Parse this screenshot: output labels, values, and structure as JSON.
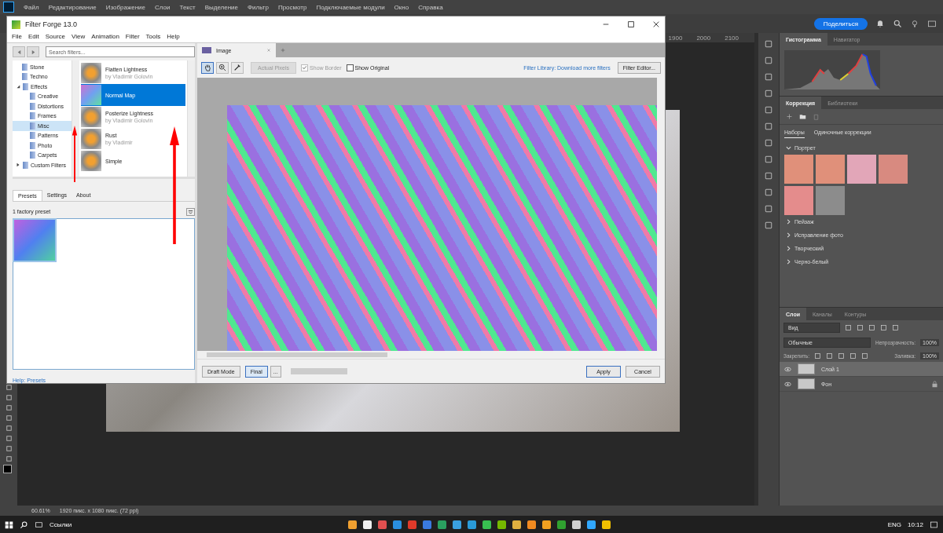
{
  "photoshop": {
    "menu": [
      "Файл",
      "Редактирование",
      "Изображение",
      "Слои",
      "Текст",
      "Выделение",
      "Фильтр",
      "Просмотр",
      "Подключаемые модули",
      "Окно",
      "Справка"
    ],
    "share_button": "Поделиться",
    "ruler": [
      "1900",
      "2000",
      "2100"
    ],
    "histogram_panel": {
      "tabs": [
        {
          "label": "Гистограмма",
          "selected": true
        },
        {
          "label": "Навигатор",
          "selected": false
        }
      ]
    },
    "adjustments_panel": {
      "tabs": [
        {
          "label": "Коррекция",
          "selected": true
        },
        {
          "label": "Библиотеки",
          "selected": false
        }
      ],
      "subtabs": [
        {
          "label": "Наборы",
          "selected": true
        },
        {
          "label": "Одиночные коррекции",
          "selected": false
        }
      ],
      "groups": [
        {
          "label": "Портрет",
          "expanded": true,
          "thumbnails": [
            {
              "color": "#e0907a"
            },
            {
              "color": "#e0907a"
            },
            {
              "color": "#e2a6b8"
            },
            {
              "color": "#d88a80"
            },
            {
              "color": "#e48c8c"
            },
            {
              "color": "#8c8c8c"
            }
          ]
        },
        {
          "label": "Пейзаж",
          "expanded": false
        },
        {
          "label": "Исправление фото",
          "expanded": false
        },
        {
          "label": "Творческий",
          "expanded": false
        },
        {
          "label": "Черно-белый",
          "expanded": false
        }
      ]
    },
    "layers_panel": {
      "tabs": [
        {
          "label": "Слои",
          "selected": true
        },
        {
          "label": "Каналы",
          "selected": false
        },
        {
          "label": "Контуры",
          "selected": false
        }
      ],
      "filter": "Вид",
      "blend_mode": "Обычные",
      "opacity_label": "Непрозрачность:",
      "opacity": "100%",
      "lock_label": "Закрепить:",
      "fill_label": "Заливка:",
      "fill": "100%",
      "layers": [
        {
          "name": "Слой 1",
          "selected": true,
          "locked": false
        },
        {
          "name": "Фон",
          "selected": false,
          "locked": true
        }
      ]
    },
    "status_bar": {
      "zoom": "60.61%",
      "doc_info": "1920 пикс. x 1080 пикс. (72 ppi)"
    }
  },
  "dialog": {
    "title": "Filter Forge 13.0",
    "menu": [
      "File",
      "Edit",
      "Source",
      "View",
      "Animation",
      "Filter",
      "Tools",
      "Help"
    ],
    "search": {
      "placeholder": "Search filters..."
    },
    "tree": [
      {
        "label": "Stone",
        "selected": false
      },
      {
        "label": "Techno",
        "selected": false
      },
      {
        "label": "Effects",
        "selected": false,
        "expanded": true,
        "children": [
          {
            "label": "Creative",
            "selected": false
          },
          {
            "label": "Distortions",
            "selected": false
          },
          {
            "label": "Frames",
            "selected": false
          },
          {
            "label": "Misc",
            "selected": true
          },
          {
            "label": "Patterns",
            "selected": false
          },
          {
            "label": "Photo",
            "selected": false
          },
          {
            "label": "Carpets",
            "selected": false
          }
        ]
      },
      {
        "label": "Custom Filters",
        "selected": false,
        "expanded": false
      }
    ],
    "filters": [
      {
        "name": "Flatten Lightness",
        "author": "by Vladimir Golovin",
        "selected": false
      },
      {
        "name": "Normal Map",
        "selected": true
      },
      {
        "name": "Posterize Lightness",
        "author": "by Vladimir Golovin",
        "selected": false
      },
      {
        "name": "Rust",
        "author": "by Vladimir",
        "selected": false
      },
      {
        "name": "Simple",
        "selected": false
      }
    ],
    "tabs": [
      {
        "label": "Presets",
        "selected": true
      },
      {
        "label": "Settings",
        "selected": false
      },
      {
        "label": "About",
        "selected": false
      }
    ],
    "preset_count": "1 factory preset",
    "presets": [
      {
        "selected": true
      }
    ],
    "help_link": "Help: Presets",
    "image_tab": "Image",
    "actual_pixels": {
      "label": "Actual Pixels",
      "disabled": true
    },
    "checkboxes": [
      {
        "label": "Show Border",
        "checked": true,
        "disabled": true
      },
      {
        "label": "Show Original",
        "checked": false,
        "disabled": false
      }
    ],
    "library_link": "Filter Library: Download more filters",
    "editor_button": "Filter Editor...",
    "render_modes": [
      {
        "label": "Draft Mode",
        "selected": false
      },
      {
        "label": "Final",
        "selected": true
      }
    ],
    "more_button": "...",
    "progress": {
      "level": 0
    },
    "buttons": [
      {
        "label": "Apply",
        "kind": "default"
      },
      {
        "label": "Cancel",
        "kind": "normal"
      }
    ]
  },
  "taskbar": {
    "search_label": "Ссылки",
    "language": "ENG",
    "time": "10:12"
  }
}
